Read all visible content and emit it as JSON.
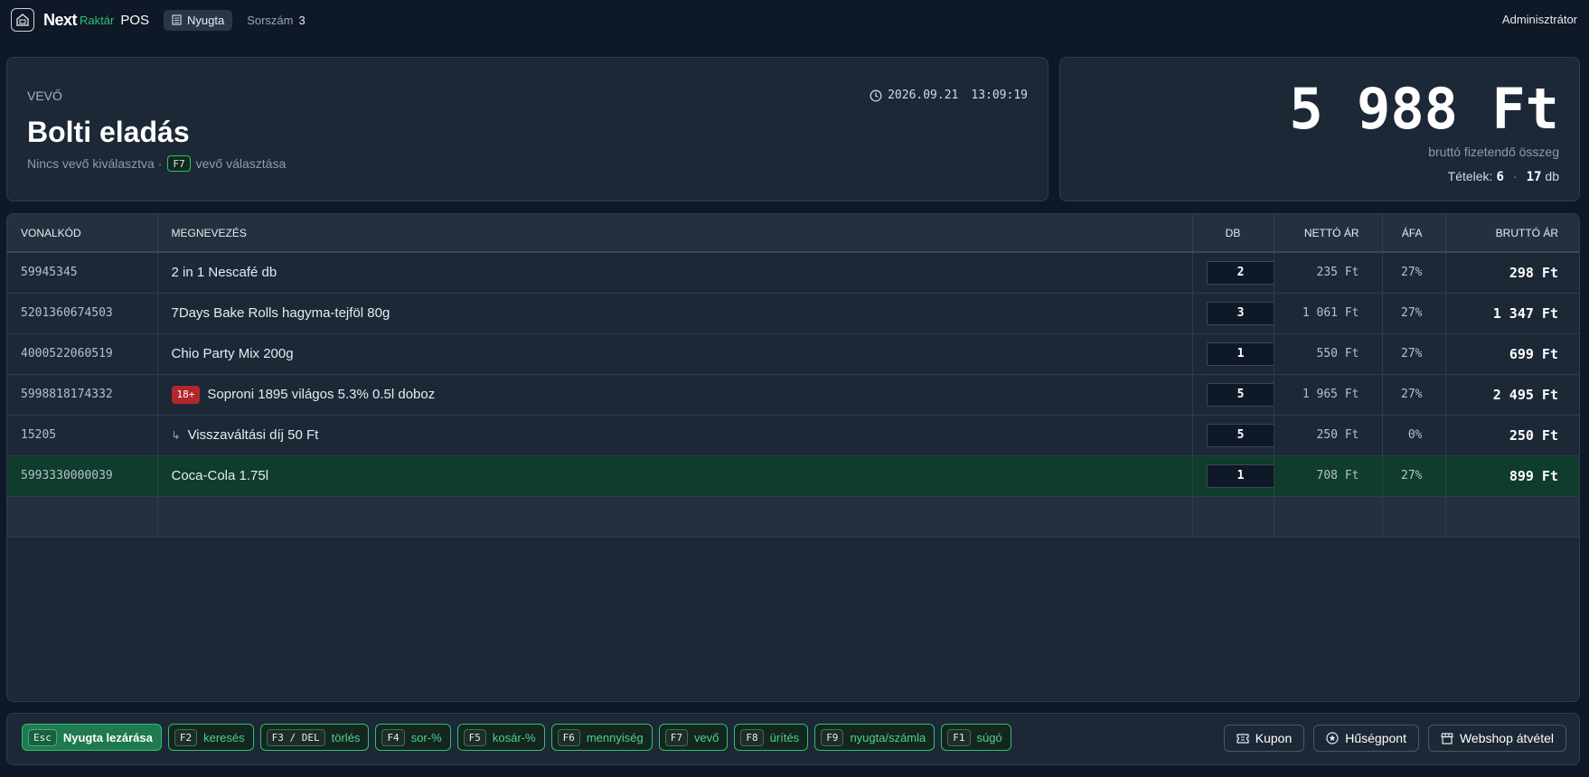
{
  "header": {
    "brand_next": "Next",
    "brand_raktar": "Raktár",
    "brand_pos": "POS",
    "mode": "Nyugta",
    "sorszam_label": "Sorszám",
    "sorszam_value": "3",
    "user": "Adminisztrátor"
  },
  "customer": {
    "label": "VEVŐ",
    "name": "Bolti eladás",
    "sub_text": "Nincs vevő kiválasztva ·",
    "key": "F7",
    "key_action": "vevő választása",
    "date": "2026.09.21",
    "time": "13:09:19"
  },
  "totals": {
    "amount": "5 988 Ft",
    "label": "bruttó fizetendő összeg",
    "items_label": "Tételek:",
    "items_lines": "6",
    "items_separator": "·",
    "items_qty": "17",
    "items_unit": "db"
  },
  "table": {
    "columns": [
      "VONALKÓD",
      "MEGNEVEZÉS",
      "DB",
      "NETTÓ ÁR",
      "ÁFA",
      "BRUTTÓ ÁR"
    ],
    "rows": [
      {
        "code": "59945345",
        "name": "2 in 1 Nescafé db",
        "qty": "2",
        "net": "235 Ft",
        "vat": "27%",
        "gross": "298 Ft"
      },
      {
        "code": "5201360674503",
        "name": "7Days Bake Rolls hagyma-tejföl 80g",
        "qty": "3",
        "net": "1 061 Ft",
        "vat": "27%",
        "gross": "1 347 Ft"
      },
      {
        "code": "4000522060519",
        "name": "Chio Party Mix 200g",
        "qty": "1",
        "net": "550 Ft",
        "vat": "27%",
        "gross": "699 Ft"
      },
      {
        "code": "5998818174332",
        "badge": "18+",
        "name": "Soproni 1895 világos 5.3% 0.5l doboz",
        "qty": "5",
        "net": "1 965 Ft",
        "vat": "27%",
        "gross": "2 495 Ft"
      },
      {
        "code": "15205",
        "sub_marker": "↳",
        "name": "Visszaváltási díj 50 Ft",
        "qty": "5",
        "net": "250 Ft",
        "vat": "0%",
        "gross": "250 Ft"
      },
      {
        "code": "5993330000039",
        "name": "Coca-Cola 1.75l",
        "qty": "1",
        "net": "708 Ft",
        "vat": "27%",
        "gross": "899 Ft"
      }
    ]
  },
  "footer": {
    "shortcuts": [
      {
        "key": "Esc",
        "label": "Nyugta lezárása"
      },
      {
        "key": "F2",
        "label": "keresés"
      },
      {
        "key": "F3 / DEL",
        "label": "törlés"
      },
      {
        "key": "F4",
        "label": "sor-%"
      },
      {
        "key": "F5",
        "label": "kosár-%"
      },
      {
        "key": "F6",
        "label": "mennyiség"
      },
      {
        "key": "F7",
        "label": "vevő"
      },
      {
        "key": "F8",
        "label": "ürítés"
      },
      {
        "key": "F9",
        "label": "nyugta/számla"
      },
      {
        "key": "F1",
        "label": "súgó"
      }
    ],
    "actions": [
      {
        "icon": "ticket-icon",
        "label": "Kupon"
      },
      {
        "icon": "star-icon",
        "label": "Hűségpont"
      },
      {
        "icon": "store-icon",
        "label": "Webshop átvétel"
      }
    ]
  },
  "colors": {
    "background": "#0f1826",
    "panel": "#1d2836",
    "accent": "#2fbf71",
    "selected_row": "#0f3c2c",
    "age_badge": "#b3262b"
  }
}
